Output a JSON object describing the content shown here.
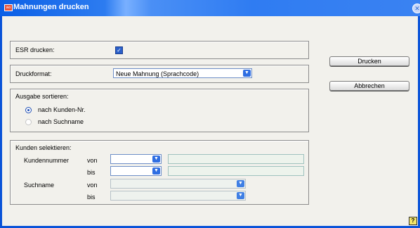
{
  "window": {
    "title": "Mahnungen drucken",
    "app_icon_text": "wo"
  },
  "esr": {
    "label": "ESR drucken:",
    "checked": true
  },
  "druckformat": {
    "label": "Druckformat:",
    "value": "Neue Mahnung (Sprachcode)"
  },
  "sortieren": {
    "label": "Ausgabe sortieren:",
    "options": [
      {
        "label": "nach Kunden-Nr.",
        "selected": true
      },
      {
        "label": "nach Suchname",
        "selected": false
      }
    ]
  },
  "kunden": {
    "label": "Kunden selektieren:",
    "kundennummer_label": "Kundennummer",
    "suchname_label": "Suchname",
    "von_label": "von",
    "bis_label": "bis"
  },
  "buttons": {
    "drucken": "Drucken",
    "abbrechen": "Abbrechen"
  },
  "help_label": "?"
}
